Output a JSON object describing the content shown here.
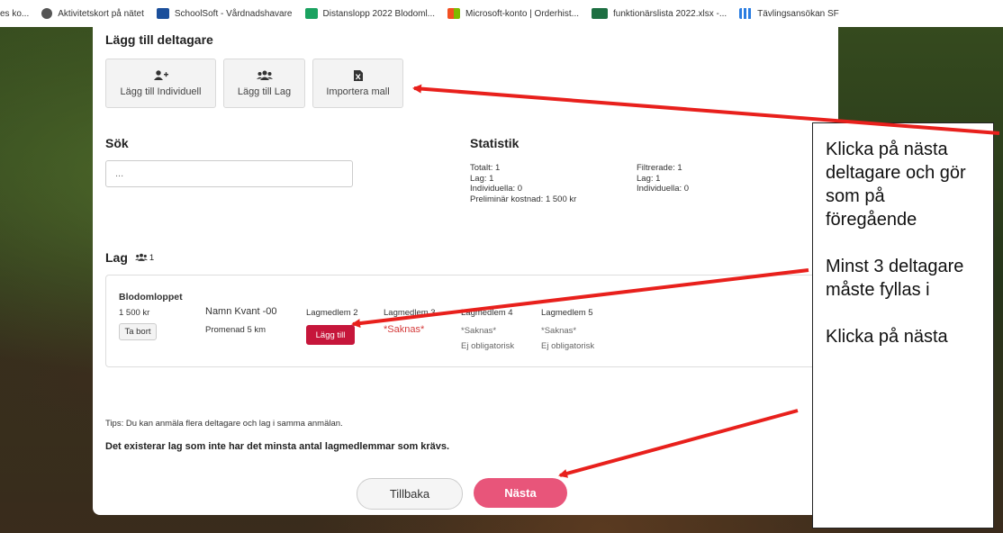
{
  "bookmarks": [
    {
      "label": "es ko...",
      "icon": "page-icon",
      "color": "#ffffff"
    },
    {
      "label": "Aktivitetskort på nätet",
      "icon": "globe-icon",
      "color": "#555555"
    },
    {
      "label": "SchoolSoft - Vårdnadshavare",
      "icon": "schoolsoft-icon",
      "color": "#1b4f9b"
    },
    {
      "label": "Distanslopp 2022 Blodoml...",
      "icon": "tile-icon",
      "color": "#1aa260"
    },
    {
      "label": "Microsoft-konto | Orderhist...",
      "icon": "microsoft-icon",
      "color": "#f25022"
    },
    {
      "label": "funktionärslista 2022.xlsx -...",
      "icon": "excel-icon",
      "color": "#1d6f42"
    },
    {
      "label": "Tävlingsansökan SF",
      "icon": "grid-icon",
      "color": "#2a7de1"
    }
  ],
  "add": {
    "title": "Lägg till deltagare",
    "individual": "Lägg till Individuell",
    "team": "Lägg till Lag",
    "import": "Importera mall"
  },
  "search": {
    "title": "Sök",
    "placeholder": "..."
  },
  "stats": {
    "title": "Statistik",
    "total": "Totalt: 1",
    "teams": "Lag: 1",
    "individuals": "Individuella: 0",
    "cost": "Preliminär kostnad: 1 500 kr",
    "filtered": "Filtrerade: 1",
    "f_teams": "Lag: 1",
    "f_individuals": "Individuella: 0"
  },
  "team_section": {
    "title": "Lag",
    "count": "1"
  },
  "team": {
    "name": "Blodomloppet",
    "price": "1 500 kr",
    "remove": "Ta bort",
    "member1_name": "Namn Kvant -00",
    "member1_race": "Promenad 5 km",
    "members": [
      {
        "label": "Lagmedlem 2",
        "add": "Lägg till"
      },
      {
        "label": "Lagmedlem 3",
        "missing": "*Saknas*"
      },
      {
        "label": "Lagmedlem 4",
        "missing": "*Saknas*",
        "optional": "Ej obligatorisk"
      },
      {
        "label": "Lagmedlem 5",
        "missing": "*Saknas*",
        "optional": "Ej obligatorisk"
      }
    ]
  },
  "tips": "Tips: Du kan anmäla flera deltagare och lag i samma anmälan.",
  "warning": "Det existerar lag som inte har det minsta antal lagmedlemmar som krävs.",
  "nav": {
    "back": "Tillbaka",
    "next": "Nästa"
  },
  "callout": {
    "p1": "Klicka på nästa deltagare och gör som på föregående",
    "p2": "Minst 3 deltagare måste fyllas i",
    "p3": "Klicka på nästa"
  },
  "colors": {
    "accent_red": "#c6163b",
    "next_pink": "#e8557a",
    "arrow_red": "#e8201c"
  }
}
